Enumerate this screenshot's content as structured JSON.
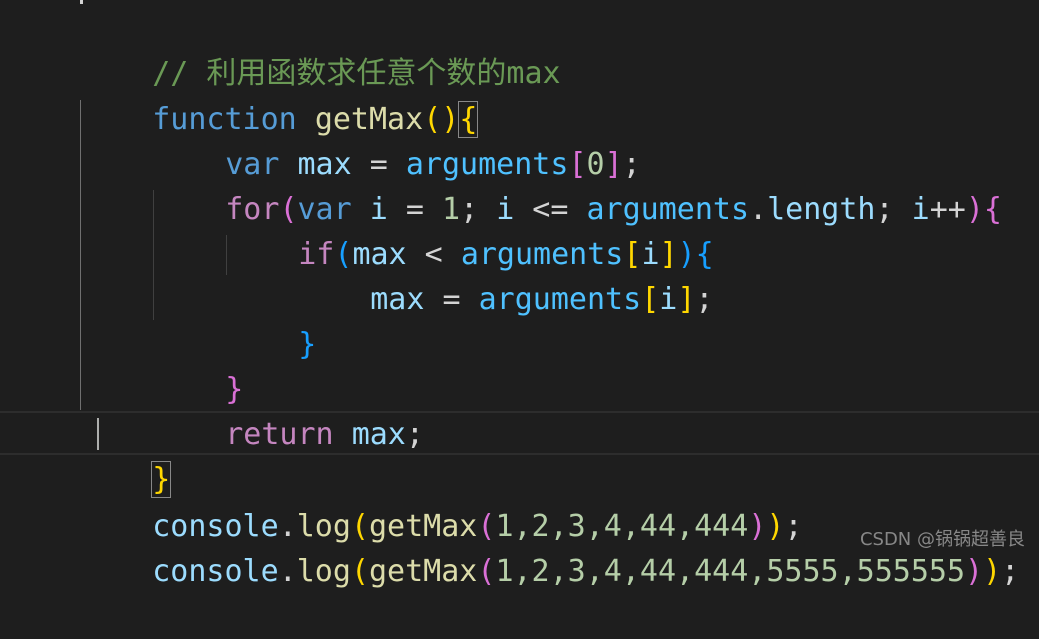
{
  "lines": {
    "comment": "// 利用函数求任意个数的max",
    "l2": [
      "function",
      " ",
      "getMax",
      "(",
      ")",
      "{"
    ],
    "l3": [
      "var",
      " ",
      "max",
      " = ",
      "arguments",
      "[",
      "0",
      "]",
      ";"
    ],
    "l4": [
      "for",
      "(",
      "var",
      " ",
      "i",
      " = ",
      "1",
      "; ",
      "i",
      " <= ",
      "arguments",
      ".",
      "length",
      "; ",
      "i",
      "++",
      ")",
      "{"
    ],
    "l5": [
      "if",
      "(",
      "max",
      " < ",
      "arguments",
      "[",
      "i",
      "]",
      ")",
      "{"
    ],
    "l6": [
      "max",
      " = ",
      "arguments",
      "[",
      "i",
      "]",
      ";"
    ],
    "l7": [
      "}"
    ],
    "l8": [
      "}"
    ],
    "l9": [
      "return",
      " ",
      "max",
      ";"
    ],
    "l10": [
      "}"
    ],
    "l11": [
      "console",
      ".",
      "log",
      "(",
      "getMax",
      "(",
      "1,2,3,4,44,444",
      ")",
      ")",
      ";"
    ],
    "l12": [
      "console",
      ".",
      "log",
      "(",
      "getMax",
      "(",
      "1,2,3,4,44,444,5555,555555",
      ")",
      ")",
      ";"
    ]
  },
  "watermark": "CSDN @锅锅超善良",
  "colors": {
    "background": "#1e1e1e",
    "comment": "#6a9955",
    "keyword": "#569cd6",
    "function": "#dcdcaa",
    "variable": "#9cdcfe",
    "arguments": "#4fc1ff",
    "control": "#c586c0",
    "number": "#b5cea8",
    "bracket1": "#ffd700",
    "bracket2": "#da70d6",
    "bracket3": "#179fff"
  }
}
